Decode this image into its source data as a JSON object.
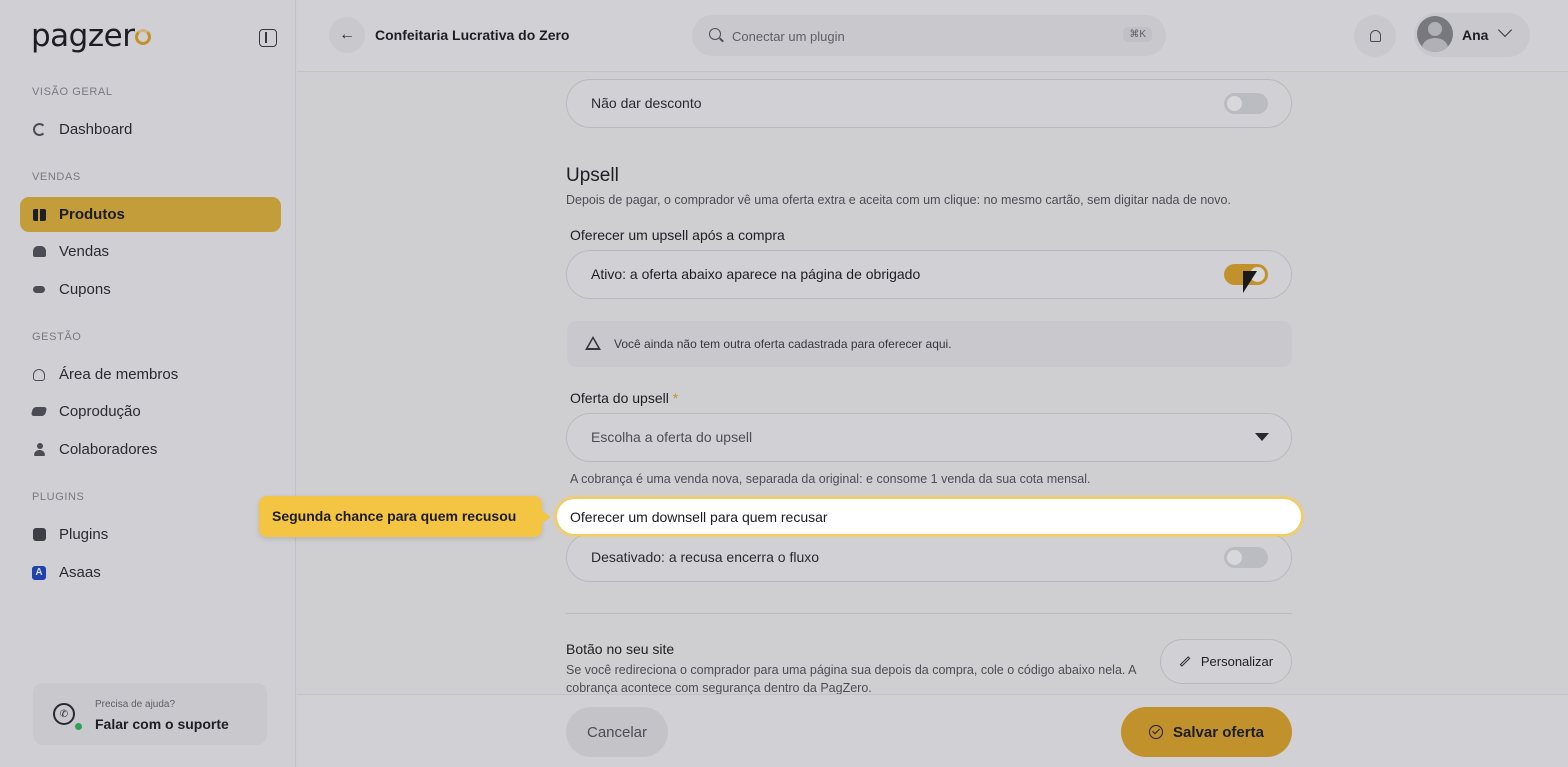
{
  "sidebar": {
    "logo_text": "pagzer",
    "sections": {
      "overview": "VISÃO GERAL",
      "sales": "VENDAS",
      "management": "GESTÃO",
      "plugins": "PLUGINS"
    },
    "items": [
      {
        "label": "Dashboard",
        "icon": "dashboard-icon"
      },
      {
        "label": "Produtos",
        "icon": "box-icon",
        "active": true
      },
      {
        "label": "Vendas",
        "icon": "hand-coin-icon"
      },
      {
        "label": "Cupons",
        "icon": "coupon-icon"
      },
      {
        "label": "Área de membros",
        "icon": "users-icon"
      },
      {
        "label": "Coprodução",
        "icon": "handshake-icon"
      },
      {
        "label": "Colaboradores",
        "icon": "person-icon"
      },
      {
        "label": "Plugins",
        "icon": "puzzle-icon"
      },
      {
        "label": "Asaas",
        "icon": "asaas-icon"
      }
    ],
    "support": {
      "question": "Precisa de ajuda?",
      "action": "Falar com o suporte"
    }
  },
  "header": {
    "title": "Confeitaria Lucrativa do Zero",
    "search_placeholder": "Conectar um plugin",
    "search_shortcut": "⌘K",
    "user_name": "Ana"
  },
  "form": {
    "discount_option": {
      "label": "Não dar desconto",
      "enabled": false
    },
    "upsell": {
      "heading": "Upsell",
      "description": "Depois de pagar, o comprador vê uma oferta extra e aceita com um clique: no mesmo cartão, sem digitar nada de novo.",
      "toggle_label": "Oferecer um upsell após a compra",
      "toggle_state_text": "Ativo: a oferta abaixo aparece na página de obrigado",
      "enabled": true,
      "warning": "Você ainda não tem outra oferta cadastrada para oferecer aqui.",
      "offer_label": "Oferta do upsell",
      "required_mark": "*",
      "offer_placeholder": "Escolha a oferta do upsell",
      "offer_help": "A cobrança é uma venda nova, separada da original: e consome 1 venda da sua cota mensal."
    },
    "downsell": {
      "label": "Oferecer um downsell para quem recusar",
      "state_text": "Desativado: a recusa encerra o fluxo",
      "enabled": false
    },
    "site_button": {
      "heading": "Botão no seu site",
      "description_line1": "Se você redireciona o comprador para uma página sua depois da compra, cole o código abaixo nela. A",
      "description_line2": "cobrança acontece com segurança dentro da PagZero.",
      "customize_label": "Personalizar"
    }
  },
  "footer": {
    "cancel_label": "Cancelar",
    "save_label": "Salvar oferta"
  },
  "tour": {
    "tooltip_text": "Segunda chance para quem recusou"
  },
  "colors": {
    "accent": "#e3aa2a",
    "active_nav": "#e5b83c",
    "tooltip": "#f4c542"
  }
}
